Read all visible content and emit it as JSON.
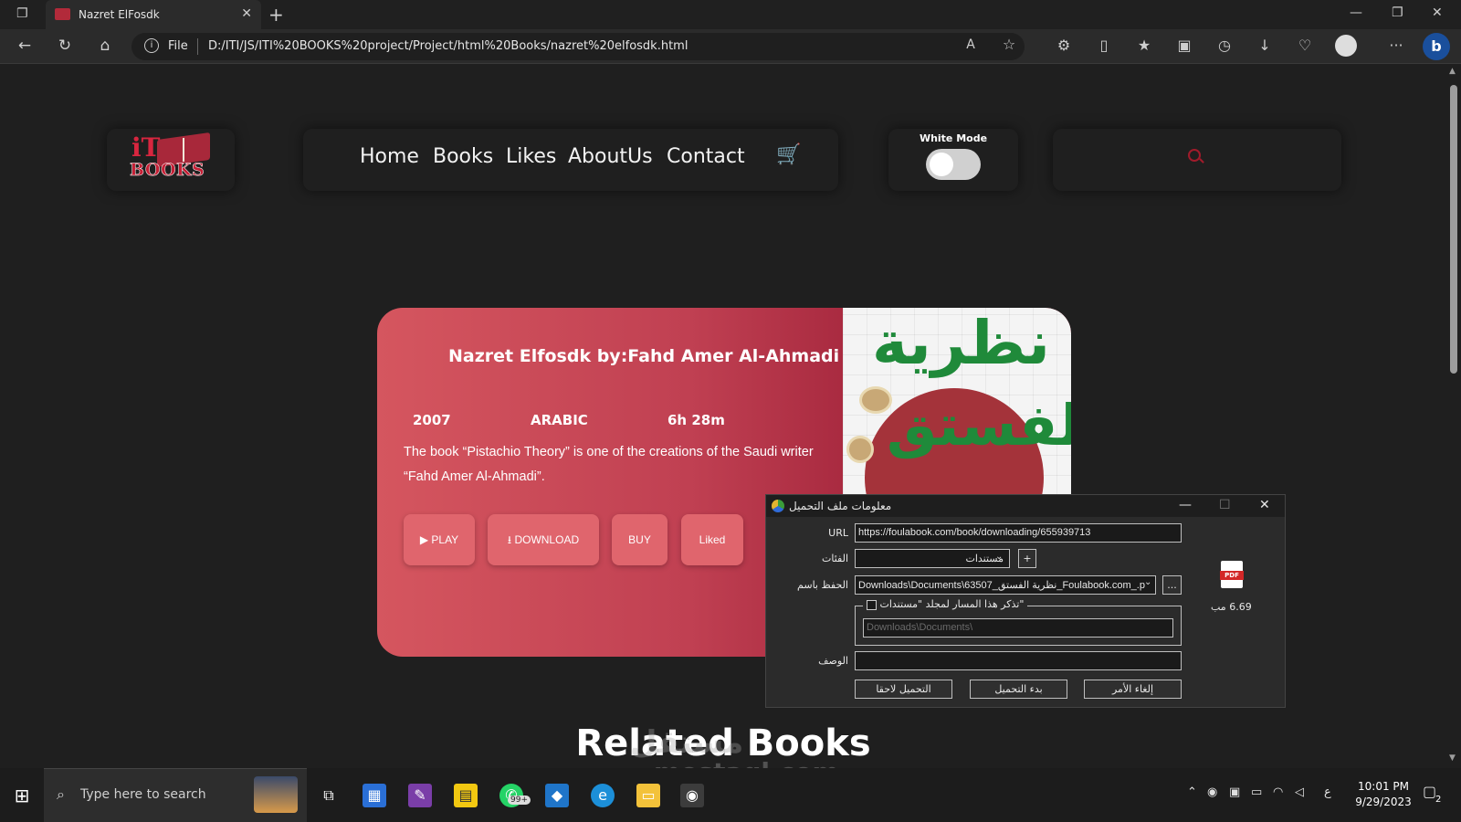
{
  "browser": {
    "tab_title": "Nazret ElFosdk",
    "url_scheme": "File",
    "url": "D:/ITI/JS/ITI%20BOOKS%20project/Project/html%20Books/nazret%20elfosdk.html"
  },
  "site": {
    "logo_text": "BOOKS",
    "nav": [
      "Home",
      "Books",
      "Likes",
      "AboutUs",
      "Contact"
    ],
    "mode_label": "White Mode"
  },
  "book": {
    "title": "Nazret Elfosdk by:Fahd Amer Al-Ahmadi",
    "year": "2007",
    "language": "ARABIC",
    "duration": "6h 28m",
    "description": "The book “Pistachio Theory” is one of the creations of the Saudi writer “Fahd Amer Al-Ahmadi”.",
    "buttons": {
      "play": "PLAY",
      "download": "DOWNLOAD",
      "buy": "BUY",
      "liked": "Liked"
    },
    "cover_text_1": "نظرية",
    "cover_text_2": "الفستق"
  },
  "related_title": "Related Books",
  "watermark": "مستقل",
  "watermark_url": "mostaql.com",
  "dialog": {
    "title": "معلومات ملف التحميل",
    "url_label": "URL",
    "url_value": "https://foulabook.com/book/downloading/655939713",
    "category_label": "الفئات",
    "category_value": "مستندات",
    "save_as_label": "الحفظ باسم",
    "save_as_value": "Downloads\\Documents\\63507_نظرية الفستق_Foulabook.com_.p",
    "remember_label": "تذكر هذا المسار لمجلد \"مستندات\"",
    "path_placeholder": "Downloads\\Documents\\",
    "description_label": "الوصف",
    "size": "6.69  مب",
    "btn_later": "التحميل لاحقا",
    "btn_start": "بدء التحميل",
    "btn_cancel": "إلغاء الأمر",
    "file_type": "PDF"
  },
  "taskbar": {
    "search_placeholder": "Type here to search",
    "badge": "99+",
    "time": "10:01 PM",
    "date": "9/29/2023",
    "lang": "ع",
    "notif_count": "2"
  }
}
